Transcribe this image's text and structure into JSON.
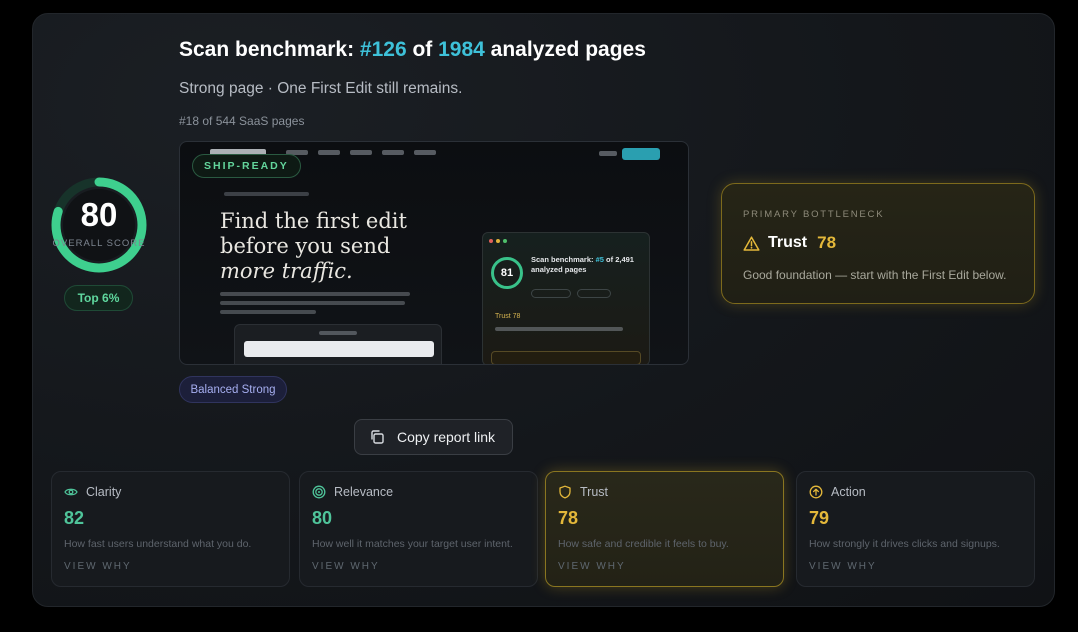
{
  "header": {
    "title_prefix": "Scan benchmark: ",
    "rank_value": "#126",
    "title_mid": " of ",
    "total_value": "1984",
    "title_suffix": " analyzed pages",
    "subtitle": "Strong page · One First Edit still remains.",
    "segment_rank": "#18 of 544 SaaS pages"
  },
  "score": {
    "value": "80",
    "label": "OVERALL SCORE",
    "fraction": 0.8,
    "badge": "Top 6%",
    "color": "#3ecf8e"
  },
  "preview": {
    "badge": "SHIP-READY",
    "headline_line1": "Find the first edit",
    "headline_line2": "before you send",
    "headline_line3": "more traffic.",
    "panel_score": "81",
    "panel_title_prefix": "Scan benchmark: ",
    "panel_rank": "#5",
    "panel_title_suffix": " of 2,491 analyzed pages",
    "panel_trust": "Trust 78"
  },
  "profile_badge": "Balanced Strong",
  "copy_button": {
    "label": "Copy report link"
  },
  "bottleneck": {
    "eyebrow": "PRIMARY BOTTLENECK",
    "name": "Trust",
    "value": "78",
    "description": "Good foundation — start with the First Edit below."
  },
  "metrics": [
    {
      "name": "Clarity",
      "value": "82",
      "description": "How fast users understand what you do.",
      "link": "VIEW WHY",
      "icon": "eye-icon"
    },
    {
      "name": "Relevance",
      "value": "80",
      "description": "How well it matches your target user intent.",
      "link": "VIEW WHY",
      "icon": "target-icon"
    },
    {
      "name": "Trust",
      "value": "78",
      "description": "How safe and credible it feels to buy.",
      "link": "VIEW WHY",
      "icon": "shield-icon"
    },
    {
      "name": "Action",
      "value": "79",
      "description": "How strongly it drives clicks and signups.",
      "link": "VIEW WHY",
      "icon": "arrow-up-circle-icon"
    }
  ],
  "colors": {
    "accent_cyan": "#3ec1d9",
    "score_green": "#3ecf8e",
    "warning_gold": "#e4b83a"
  }
}
